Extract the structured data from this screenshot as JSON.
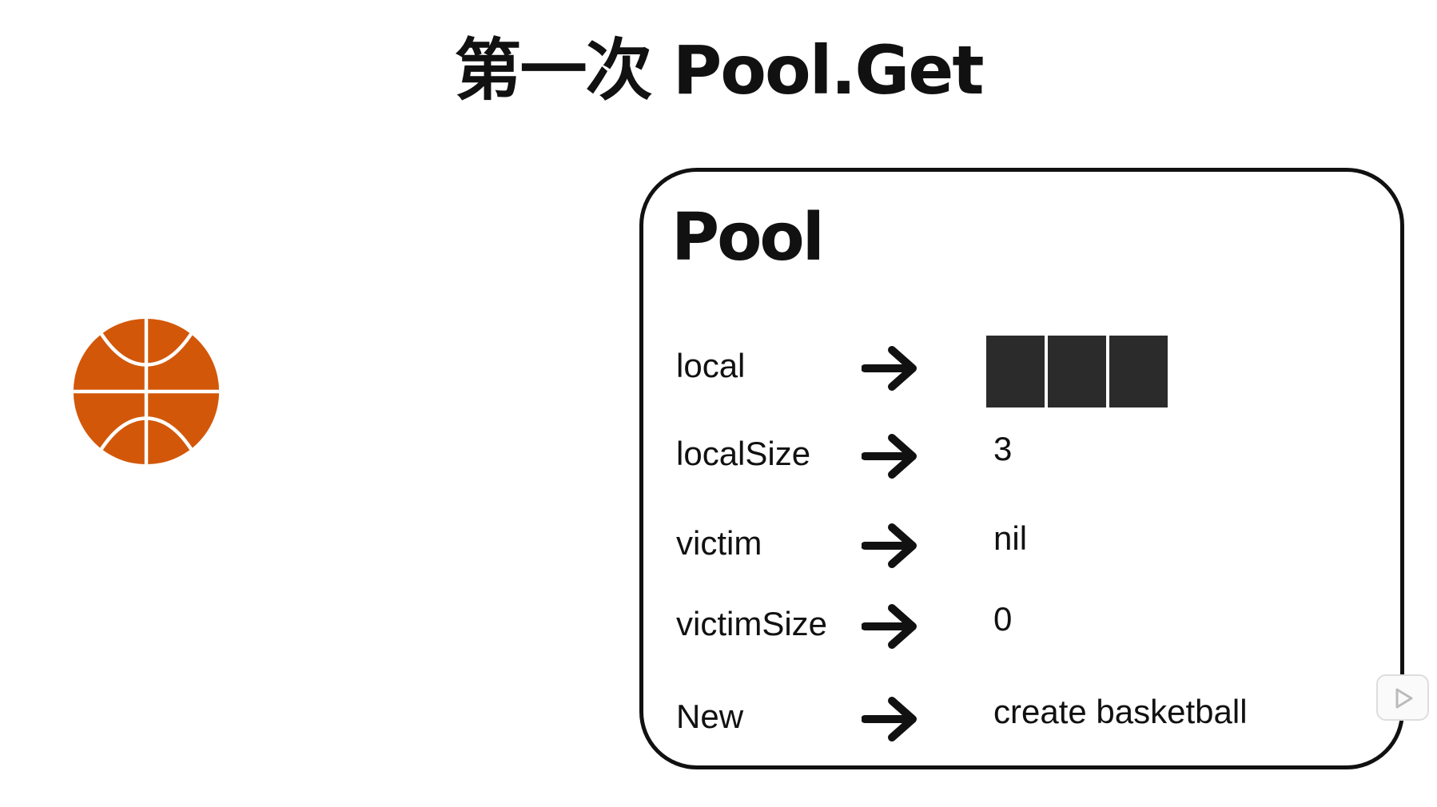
{
  "title": "第一次 Pool.Get",
  "colors": {
    "ball": "#d35709",
    "ball_lines": "#ffffff",
    "slot_fill": "#2b2b2b",
    "ink": "#111111"
  },
  "icons": {
    "object": "basketball-icon",
    "connector": "arrow-right-icon",
    "media": "play-icon"
  },
  "pool": {
    "title": "Pool",
    "local_slots": 3,
    "fields": [
      {
        "name": "local",
        "value": ""
      },
      {
        "name": "localSize",
        "value": "3"
      },
      {
        "name": "victim",
        "value": "nil"
      },
      {
        "name": "victimSize",
        "value": "0"
      },
      {
        "name": "New",
        "value": "create basketball"
      }
    ]
  }
}
